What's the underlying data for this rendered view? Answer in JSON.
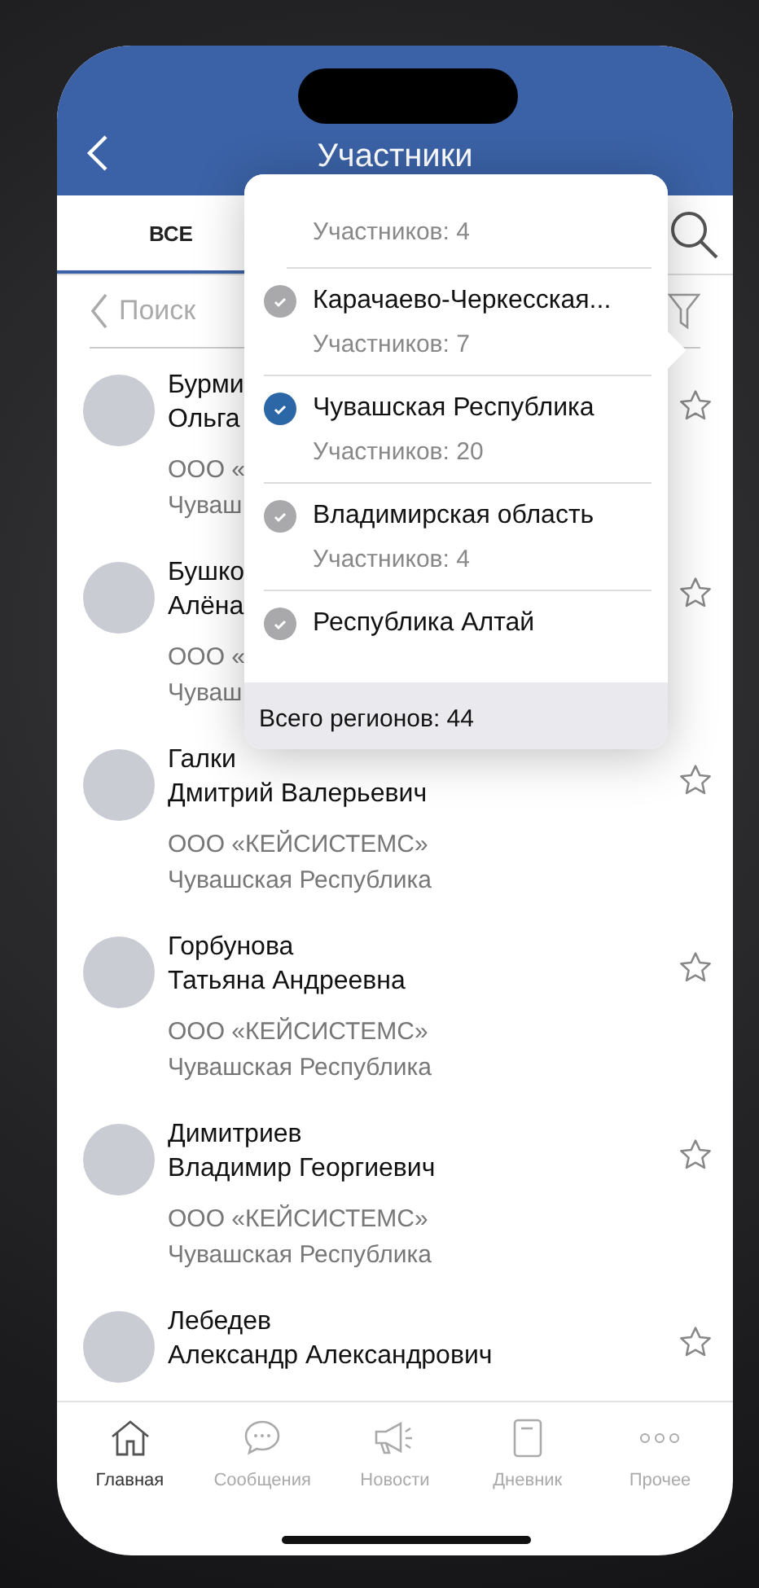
{
  "header": {
    "title": "Участники"
  },
  "tabs": [
    {
      "label": "ВСЕ",
      "selected": true
    }
  ],
  "search": {
    "placeholder": "Поиск"
  },
  "participants": [
    {
      "name_line1": "Бурми",
      "name_line2": "Ольга",
      "org": "ООО «",
      "region": "Чуваш",
      "starred": false
    },
    {
      "name_line1": "Бушко",
      "name_line2": "Алёна",
      "org": "ООО «",
      "region": "Чуваш",
      "starred": false
    },
    {
      "name_line1": "Галки",
      "name_line2": "Дмитрий Валерьевич",
      "org": "ООО «КЕЙСИСТЕМС»",
      "region": "Чувашская Республика",
      "starred": false
    },
    {
      "name_line1": "Горбунова",
      "name_line2": "Татьяна Андреевна",
      "org": "ООО «КЕЙСИСТЕМС»",
      "region": "Чувашская Республика",
      "starred": false
    },
    {
      "name_line1": "Димитриев",
      "name_line2": "Владимир Георгиевич",
      "org": "ООО «КЕЙСИСТЕМС»",
      "region": "Чувашская Республика",
      "starred": false
    },
    {
      "name_line1": "Лебедев",
      "name_line2": "Александр Александрович",
      "starred": false
    }
  ],
  "region_filter": {
    "partial_top": {
      "count": "Участников: 4"
    },
    "regions": [
      {
        "name": "Карачаево-Черкесская...",
        "count": "Участников: 7",
        "selected": false
      },
      {
        "name": "Чувашская Республика",
        "count": "Участников: 20",
        "selected": true
      },
      {
        "name": "Владимирская область",
        "count": "Участников: 4",
        "selected": false
      },
      {
        "name": "Республика Алтай",
        "selected": false
      }
    ],
    "total": "Всего регионов: 44"
  },
  "tab_bar": [
    {
      "kind": "home",
      "label": "Главная",
      "selected": true
    },
    {
      "kind": "chat",
      "label": "Сообщения",
      "selected": false
    },
    {
      "kind": "megaphone",
      "label": "Новости",
      "selected": false
    },
    {
      "kind": "notebook",
      "label": "Дневник",
      "selected": false
    },
    {
      "kind": "dots",
      "label": "Прочее",
      "selected": false
    }
  ]
}
